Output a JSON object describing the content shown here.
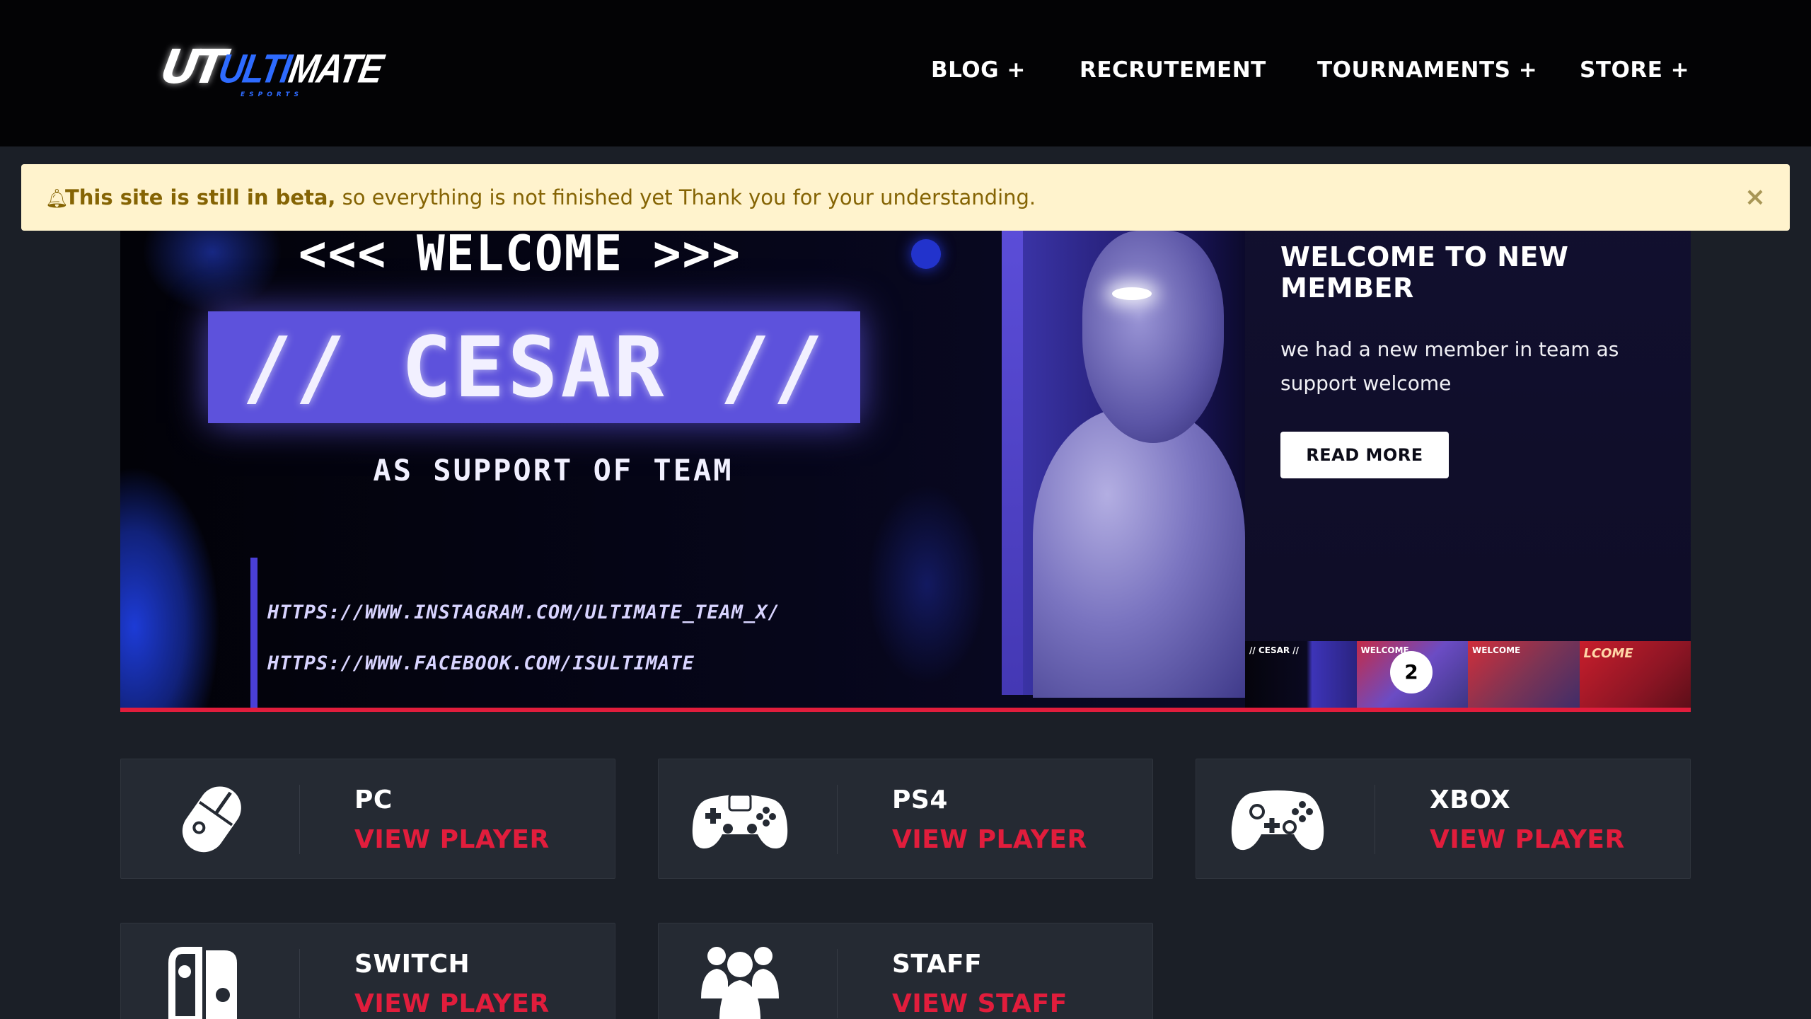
{
  "brand": {
    "logo_mark": "UT",
    "logo_word_hl": "ULTI",
    "logo_word": "MATE",
    "logo_sub": "ESPORTS"
  },
  "nav": {
    "items": [
      {
        "label": "BLOG +"
      },
      {
        "label": "RECRUTEMENT"
      },
      {
        "label": "TOURNAMENTS +"
      },
      {
        "label": "STORE +"
      }
    ]
  },
  "alert": {
    "icon": "bell-icon",
    "strong": "This site is still in beta,",
    "text": " so everything is not finished yet Thank you for your understanding.",
    "close": "×"
  },
  "hero": {
    "welcome": "<<< WELCOME >>>",
    "name": "// CESAR //",
    "subtitle": "AS SUPPORT OF TEAM",
    "link_instagram": "HTTPS://WWW.INSTAGRAM.COM/ULTIMATE_TEAM_X/",
    "link_facebook": "HTTPS://WWW.FACEBOOK.COM/ISULTIMATE",
    "side_title": "WELCOME TO NEW MEMBER",
    "side_text": "we had a new member in team as support welcome",
    "read_more": "READ MORE",
    "slide_number": "2",
    "thumbs": [
      {
        "label": "// CESAR //"
      },
      {
        "label": "WELCOME"
      },
      {
        "label": "WELCOME"
      },
      {
        "label": "LCOME"
      }
    ]
  },
  "cards": [
    {
      "title": "PC",
      "link": "VIEW PLAYER",
      "icon": "mouse-icon"
    },
    {
      "title": "PS4",
      "link": "VIEW PLAYER",
      "icon": "ps4-controller-icon"
    },
    {
      "title": "XBOX",
      "link": "VIEW PLAYER",
      "icon": "xbox-controller-icon"
    },
    {
      "title": "SWITCH",
      "link": "VIEW PLAYER",
      "icon": "switch-icon"
    },
    {
      "title": "STAFF",
      "link": "VIEW STAFF",
      "icon": "group-icon"
    }
  ],
  "colors": {
    "accent": "#e11d3c",
    "alert_bg": "#fff3cd",
    "alert_text": "#856404",
    "page_bg": "#1b1f27",
    "card_bg": "#252a33"
  }
}
